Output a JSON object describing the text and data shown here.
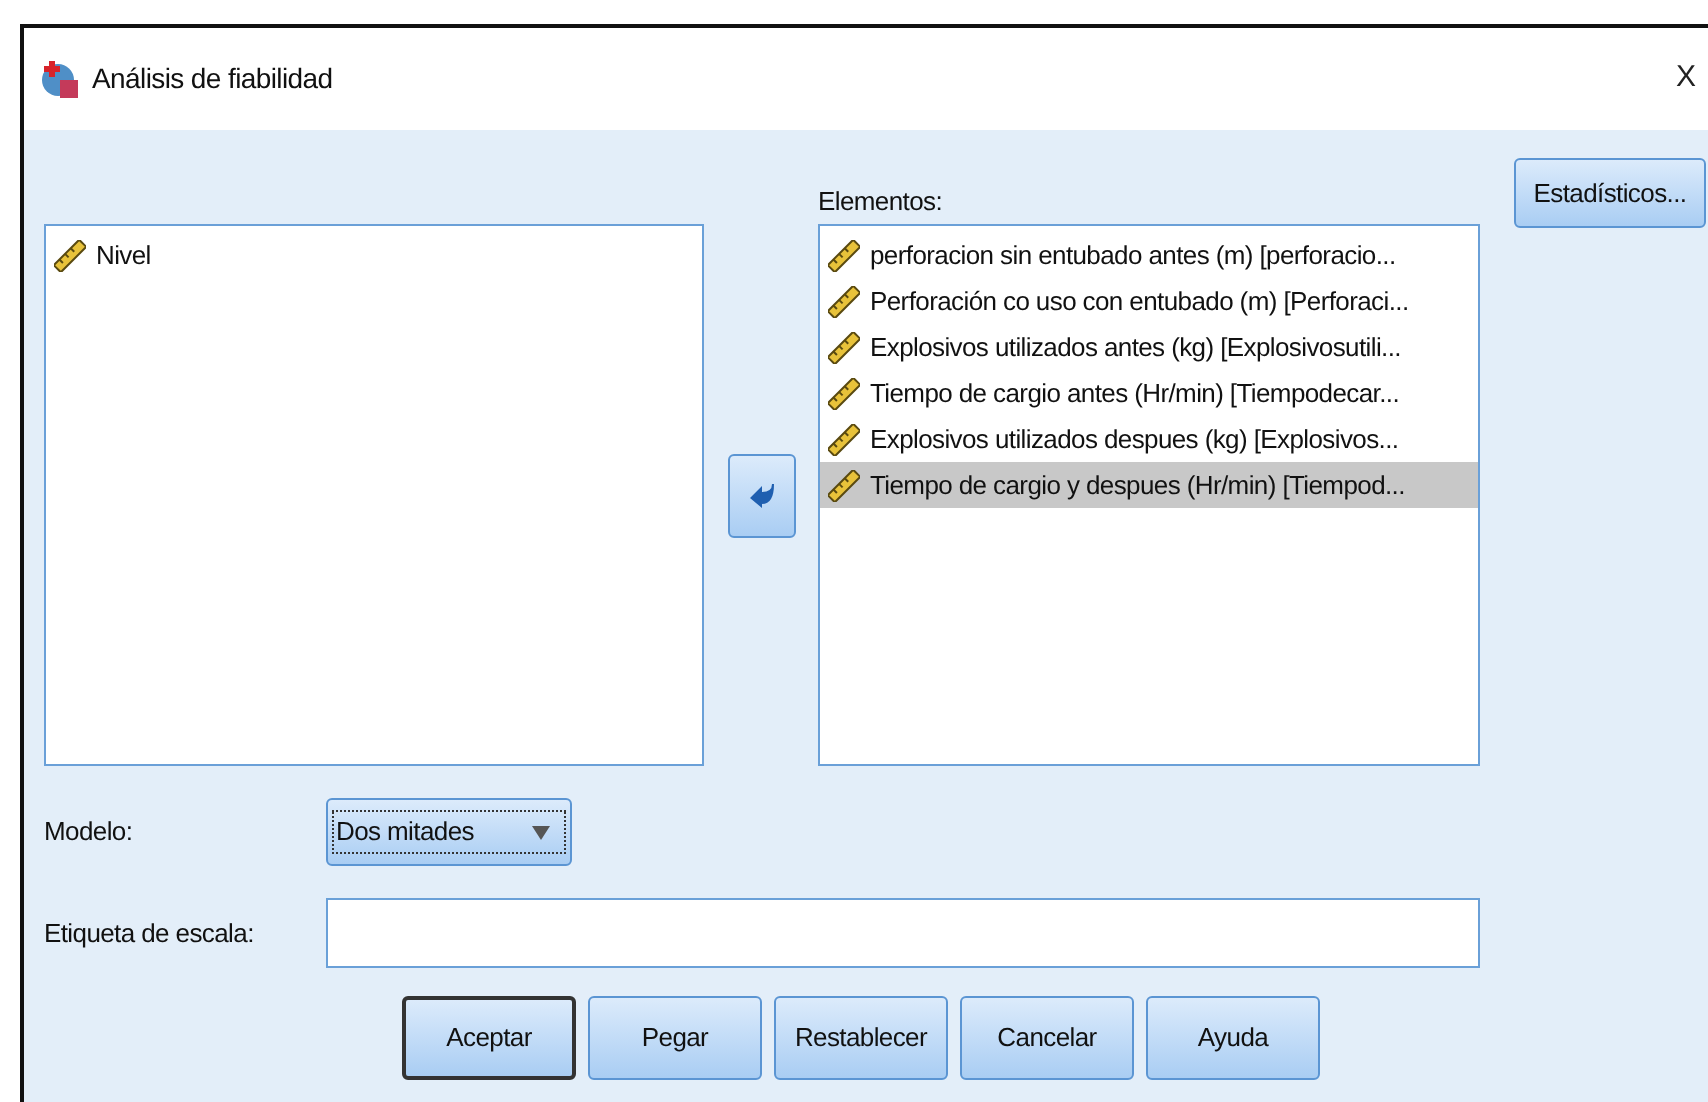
{
  "window": {
    "title": "Análisis de fiabilidad",
    "close": "X"
  },
  "variables": [
    {
      "label": "Nivel",
      "selected": false
    }
  ],
  "items_label": "Elementos:",
  "items": [
    {
      "label": "perforacion sin entubado antes (m) [perforacio...",
      "selected": false
    },
    {
      "label": "Perforación co uso con entubado (m) [Perforaci...",
      "selected": false
    },
    {
      "label": "Explosivos utilizados antes (kg) [Explosivosutili...",
      "selected": false
    },
    {
      "label": "Tiempo de cargio antes (Hr/min) [Tiempodecar...",
      "selected": false
    },
    {
      "label": "Explosivos utilizados despues (kg) [Explosivos...",
      "selected": false
    },
    {
      "label": "Tiempo de cargio y despues (Hr/min) [Tiempod...",
      "selected": true
    }
  ],
  "statistics_button": "Estadísticos...",
  "model": {
    "label": "Modelo:",
    "value": "Dos mitades"
  },
  "scale_label": {
    "label": "Etiqueta de escala:"
  },
  "buttons": [
    {
      "label": "Aceptar",
      "default": true
    },
    {
      "label": "Pegar",
      "default": false
    },
    {
      "label": "Restablecer",
      "default": false
    },
    {
      "label": "Cancelar",
      "default": false
    },
    {
      "label": "Ayuda",
      "default": false
    }
  ]
}
